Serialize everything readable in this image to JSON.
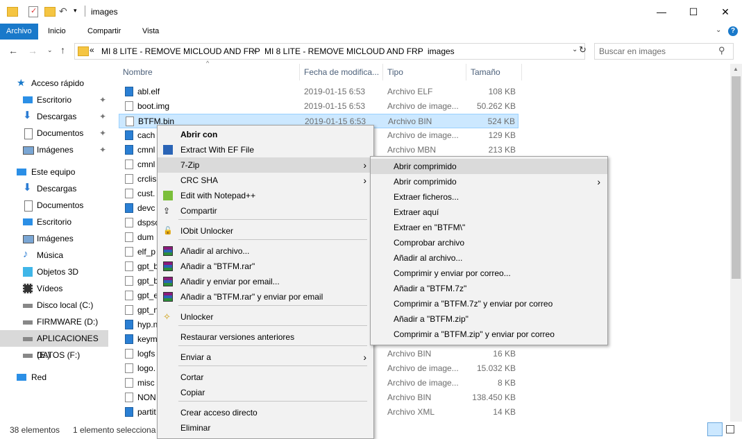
{
  "window": {
    "title": "images"
  },
  "ribbon": {
    "tabs": [
      "Archivo",
      "Inicio",
      "Compartir",
      "Vista"
    ]
  },
  "address": {
    "crumb_overflow": "«",
    "crumbs": [
      "MI 8 LITE - REMOVE MICLOUD AND FRP",
      "MI 8 LITE - REMOVE MICLOUD AND FRP",
      "images"
    ],
    "search_placeholder": "Buscar en images"
  },
  "nav": {
    "items": [
      "Acceso rápido",
      "Escritorio",
      "Descargas",
      "Documentos",
      "Imágenes",
      "Este equipo",
      "Descargas",
      "Documentos",
      "Escritorio",
      "Imágenes",
      "Música",
      "Objetos 3D",
      "Vídeos",
      "Disco local (C:)",
      "FIRMWARE (D:)",
      "APLICACIONES (E:)",
      "DATOS (F:)",
      "Red"
    ]
  },
  "columns": {
    "name": "Nombre",
    "date": "Fecha de modifica...",
    "type": "Tipo",
    "size": "Tamaño"
  },
  "files": [
    {
      "name": "abl.elf",
      "date": "2019-01-15 6:53",
      "type": "Archivo ELF",
      "size": "108 KB"
    },
    {
      "name": "boot.img",
      "date": "2019-01-15 6:53",
      "type": "Archivo de image...",
      "size": "50.262 KB"
    },
    {
      "name": "BTFM.bin",
      "date": "2019-01-15 6:53",
      "type": "Archivo BIN",
      "size": "524 KB"
    },
    {
      "name": "cach",
      "date": "",
      "type": "Archivo de image...",
      "size": "129 KB"
    },
    {
      "name": "cmnl",
      "date": "",
      "type": "Archivo MBN",
      "size": "213 KB"
    },
    {
      "name": "cmnl",
      "date": "",
      "type": "",
      "size": ""
    },
    {
      "name": "crclis",
      "date": "",
      "type": "",
      "size": ""
    },
    {
      "name": "cust.",
      "date": "",
      "type": "",
      "size": ""
    },
    {
      "name": "devc",
      "date": "",
      "type": "",
      "size": ""
    },
    {
      "name": "dspsc",
      "date": "",
      "type": "",
      "size": ""
    },
    {
      "name": "dum",
      "date": "",
      "type": "",
      "size": ""
    },
    {
      "name": "elf_p",
      "date": "",
      "type": "",
      "size": ""
    },
    {
      "name": "gpt_b",
      "date": "",
      "type": "",
      "size": ""
    },
    {
      "name": "gpt_b",
      "date": "",
      "type": "",
      "size": ""
    },
    {
      "name": "gpt_e",
      "date": "",
      "type": "",
      "size": ""
    },
    {
      "name": "gpt_n",
      "date": "",
      "type": "",
      "size": ""
    },
    {
      "name": "hyp.n",
      "date": "",
      "type": "",
      "size": ""
    },
    {
      "name": "keym",
      "date": "",
      "type": "",
      "size": ""
    },
    {
      "name": "logfs",
      "date": "",
      "type": "Archivo BIN",
      "size": "16 KB"
    },
    {
      "name": "logo.",
      "date": "",
      "type": "Archivo de image...",
      "size": "15.032 KB"
    },
    {
      "name": "misc",
      "date": "",
      "type": "Archivo de image...",
      "size": "8 KB"
    },
    {
      "name": "NON",
      "date": "",
      "type": "Archivo BIN",
      "size": "138.450 KB"
    },
    {
      "name": "partit",
      "date": "",
      "type": "Archivo XML",
      "size": "14 KB"
    }
  ],
  "context_menu": {
    "items": [
      "Abrir con",
      "Extract With EF File",
      "7-Zip",
      "CRC SHA",
      "Edit with Notepad++",
      "Compartir",
      "IObit Unlocker",
      "Añadir al archivo...",
      "Añadir a \"BTFM.rar\"",
      "Añadir y enviar por email...",
      "Añadir a \"BTFM.rar\" y enviar por email",
      "Unlocker",
      "Restaurar versiones anteriores",
      "Enviar a",
      "Cortar",
      "Copiar",
      "Crear acceso directo",
      "Eliminar"
    ]
  },
  "submenu": {
    "items": [
      "Abrir comprimido",
      "Abrir comprimido",
      "Extraer ficheros...",
      "Extraer aquí",
      "Extraer en \"BTFM\\\"",
      "Comprobar archivo",
      "Añadir al archivo...",
      "Comprimir y enviar por correo...",
      "Añadir a \"BTFM.7z\"",
      "Comprimir a \"BTFM.7z\" y enviar por correo",
      "Añadir a \"BTFM.zip\"",
      "Comprimir a \"BTFM.zip\" y enviar por correo"
    ]
  },
  "status": {
    "count": "38 elementos",
    "selected": "1 elemento selecciona"
  },
  "colors": {
    "accent": "#1979ca",
    "selection": "#cce8ff"
  }
}
